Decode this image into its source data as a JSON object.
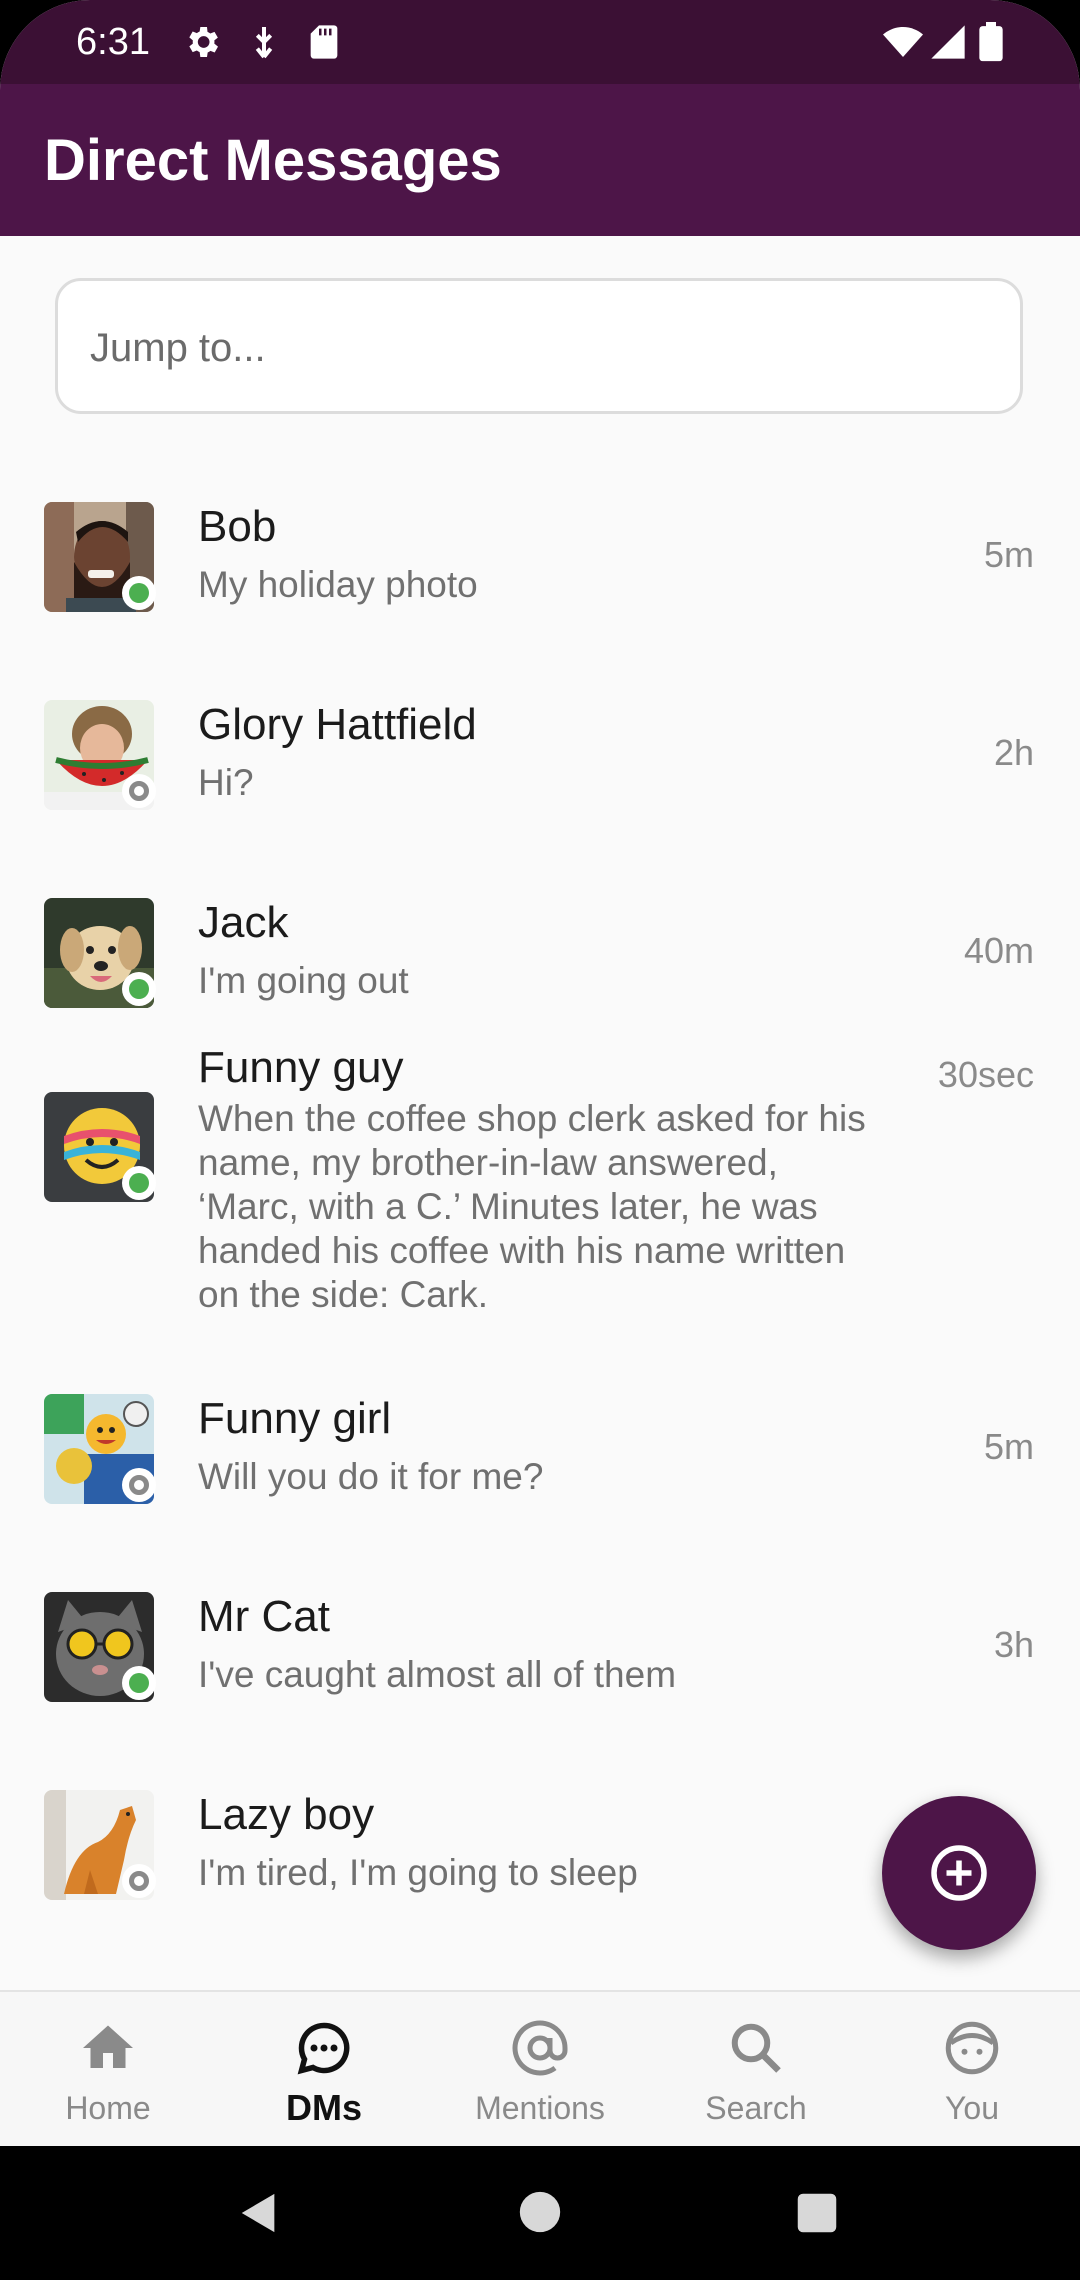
{
  "status_bar": {
    "time": "6:31",
    "icons": [
      "gear-icon",
      "usb-icon",
      "sd-card-icon",
      "wifi-icon",
      "signal-icon",
      "battery-icon"
    ]
  },
  "app_bar": {
    "title": "Direct Messages"
  },
  "search": {
    "placeholder": "Jump to..."
  },
  "dms": [
    {
      "name": "Bob",
      "message": "My holiday photo",
      "time": "5m",
      "online": true,
      "avatar": "man-portrait"
    },
    {
      "name": "Glory Hattfield",
      "message": "Hi?",
      "time": "2h",
      "online": false,
      "avatar": "girl-watermelon"
    },
    {
      "name": "Jack",
      "message": "I'm going out",
      "time": "40m",
      "online": true,
      "avatar": "dog"
    },
    {
      "name": "Funny guy",
      "message": "When the coffee shop clerk asked for his name, my brother-in-law answered, ‘Marc, with a C.’ Minutes later, he was handed his coffee with his name written on the side: Cark.",
      "time": "30sec",
      "online": true,
      "avatar": "smiley-sticker"
    },
    {
      "name": "Funny girl",
      "message": "Will you do it for me?",
      "time": "5m",
      "online": false,
      "avatar": "emoji-collage"
    },
    {
      "name": "Mr Cat",
      "message": "I've caught almost all of them",
      "time": "3h",
      "online": true,
      "avatar": "cat-sunglasses"
    },
    {
      "name": "Lazy boy",
      "message": "I'm tired, I'm going to sleep",
      "time": "",
      "online": false,
      "avatar": "cat-stretching"
    }
  ],
  "fab": {
    "icon": "add-circle-icon"
  },
  "bottom_nav": [
    {
      "label": "Home",
      "icon": "home-icon",
      "active": false
    },
    {
      "label": "DMs",
      "icon": "chat-bubble-icon",
      "active": true
    },
    {
      "label": "Mentions",
      "icon": "at-sign-icon",
      "active": false
    },
    {
      "label": "Search",
      "icon": "search-icon",
      "active": false
    },
    {
      "label": "You",
      "icon": "face-icon",
      "active": false
    }
  ],
  "colors": {
    "status_bar": "#3b1034",
    "app_bar": "#4d1548",
    "online": "#4caf50",
    "offline": "#8a8a8a"
  }
}
